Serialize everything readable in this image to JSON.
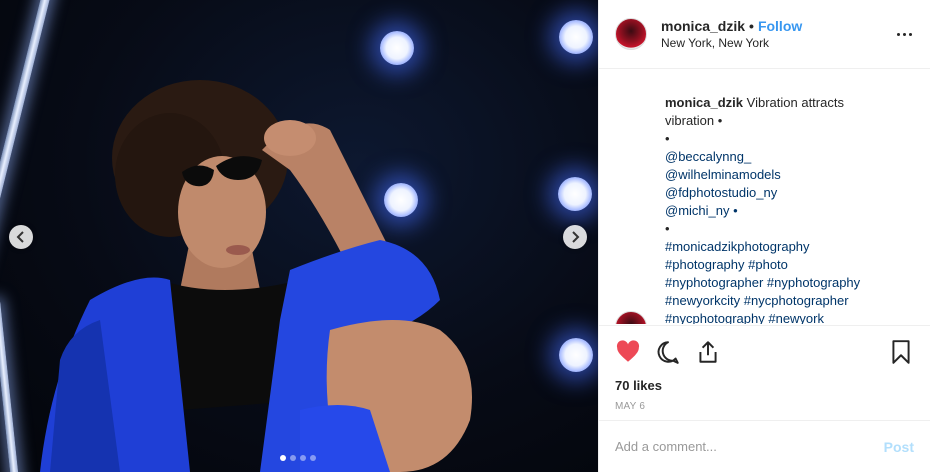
{
  "header": {
    "username": "monica_dzik",
    "separator": "•",
    "follow_label": "Follow",
    "location": "New York, New York",
    "avatar_icon": "profile-avatar",
    "more_icon": "more-options-icon"
  },
  "carousel": {
    "prev_icon": "chevron-left-icon",
    "next_icon": "chevron-right-icon",
    "slide_count": 4,
    "active_slide": 1
  },
  "caption": {
    "username": "monica_dzik",
    "text": "Vibration attracts vibration •",
    "lines": [
      "•",
      "@beccalynng_",
      "@wilhelminamodels",
      "@fdphotostudio_ny",
      "@michi_ny •",
      "•",
      "#monicadzikphotography",
      "#photography #photo",
      "#nyphotographer #nyphotography",
      "#newyorkcity #nycphotographer",
      "#nycphotography #newyork"
    ]
  },
  "actions": {
    "like_icon": "heart-icon",
    "comment_icon": "comment-icon",
    "share_icon": "share-icon",
    "save_icon": "bookmark-icon",
    "like_color": "#ed4956",
    "likes_text": "70 likes",
    "date": "MAY 6"
  },
  "comment_box": {
    "placeholder": "Add a comment...",
    "post_label": "Post"
  }
}
